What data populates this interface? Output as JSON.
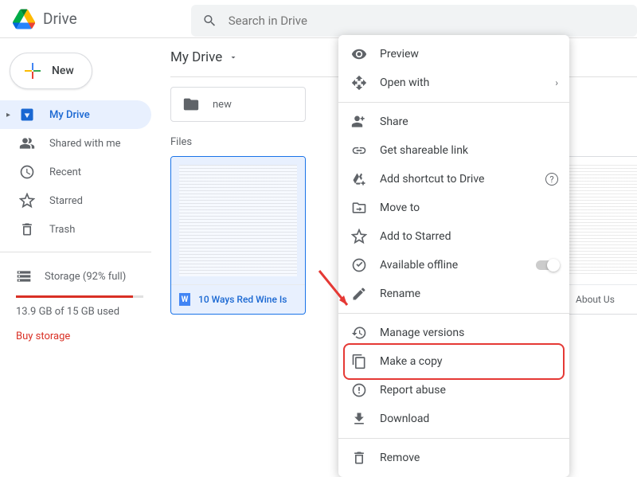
{
  "header": {
    "app_name": "Drive",
    "search_placeholder": "Search in Drive"
  },
  "sidebar": {
    "new_label": "New",
    "items": [
      {
        "label": "My Drive"
      },
      {
        "label": "Shared with me"
      },
      {
        "label": "Recent"
      },
      {
        "label": "Starred"
      },
      {
        "label": "Trash"
      }
    ],
    "storage_label": "Storage (92% full)",
    "storage_used": "13.9 GB of 15 GB used",
    "buy_label": "Buy storage"
  },
  "content": {
    "breadcrumb": "My Drive",
    "folder_name": "new",
    "section_label": "Files",
    "files": [
      {
        "name": "10 Ways Red Wine Is"
      },
      {
        "name": "About Us"
      }
    ]
  },
  "menu": {
    "preview": "Preview",
    "open_with": "Open with",
    "share": "Share",
    "get_link": "Get shareable link",
    "add_shortcut": "Add shortcut to Drive",
    "move_to": "Move to",
    "add_starred": "Add to Starred",
    "available_offline": "Available offline",
    "rename": "Rename",
    "manage_versions": "Manage versions",
    "make_copy": "Make a copy",
    "report_abuse": "Report abuse",
    "download": "Download",
    "remove": "Remove"
  }
}
